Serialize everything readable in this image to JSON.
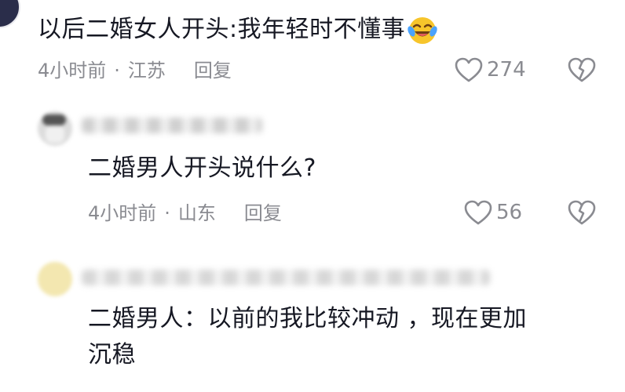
{
  "comments": [
    {
      "text": "以后二婚女人开头:我年轻时不懂事",
      "emoji": "laughing-tears-emoji",
      "time": "4小时前",
      "dot": "·",
      "location": "江苏",
      "reply_label": "回复",
      "likes": "274"
    }
  ],
  "replies": [
    {
      "text": "二婚男人开头说什么?",
      "time": "4小时前",
      "dot": "·",
      "location": "山东",
      "reply_label": "回复",
      "likes": "56"
    },
    {
      "text_line1": "二婚男人：以前的我比较冲动 ，现在更加",
      "text_line2": "沉稳"
    }
  ],
  "icons": {
    "like": "heart-outline-icon",
    "dislike": "broken-heart-icon"
  },
  "colors": {
    "text_primary": "#161823",
    "text_meta": "#8a8b91",
    "icon": "#8a8b91"
  }
}
